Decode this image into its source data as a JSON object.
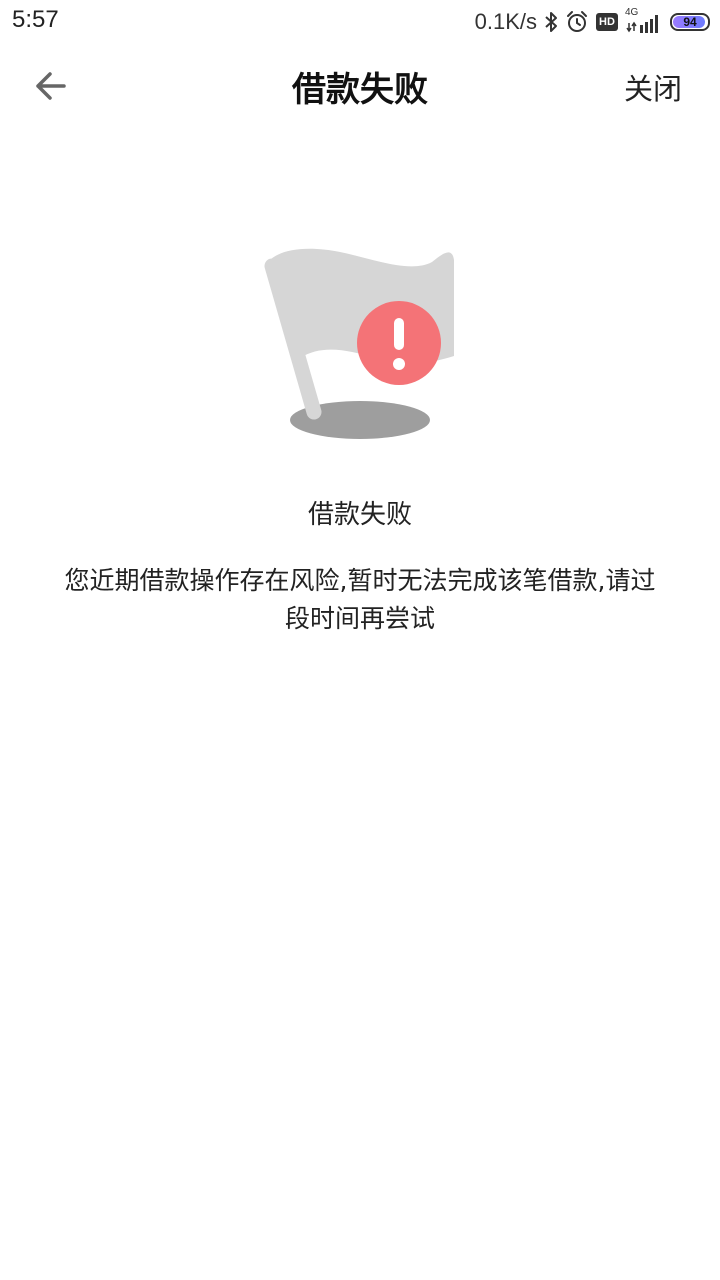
{
  "status_bar": {
    "time": "5:57",
    "net_speed": "0.1K/s",
    "hd_badge": "HD",
    "network_type": "4G",
    "battery_level": "94",
    "battery_fraction": 0.94,
    "icons": [
      "bluetooth-icon",
      "alarm-icon",
      "hd-icon",
      "signal-icon",
      "battery-icon"
    ]
  },
  "nav": {
    "title": "借款失败",
    "close_label": "关闭",
    "back_icon": "arrow-left-icon"
  },
  "result": {
    "illustration_icon": "flag-error-icon",
    "title": "借款失败",
    "message": "您近期借款操作存在风险,暂时无法完成该笔借款,请过段时间再尝试"
  },
  "colors": {
    "flag": "#d6d6d6",
    "flag_shadow": "#9e9e9e",
    "error_badge": "#f47377",
    "text": "#111111"
  }
}
